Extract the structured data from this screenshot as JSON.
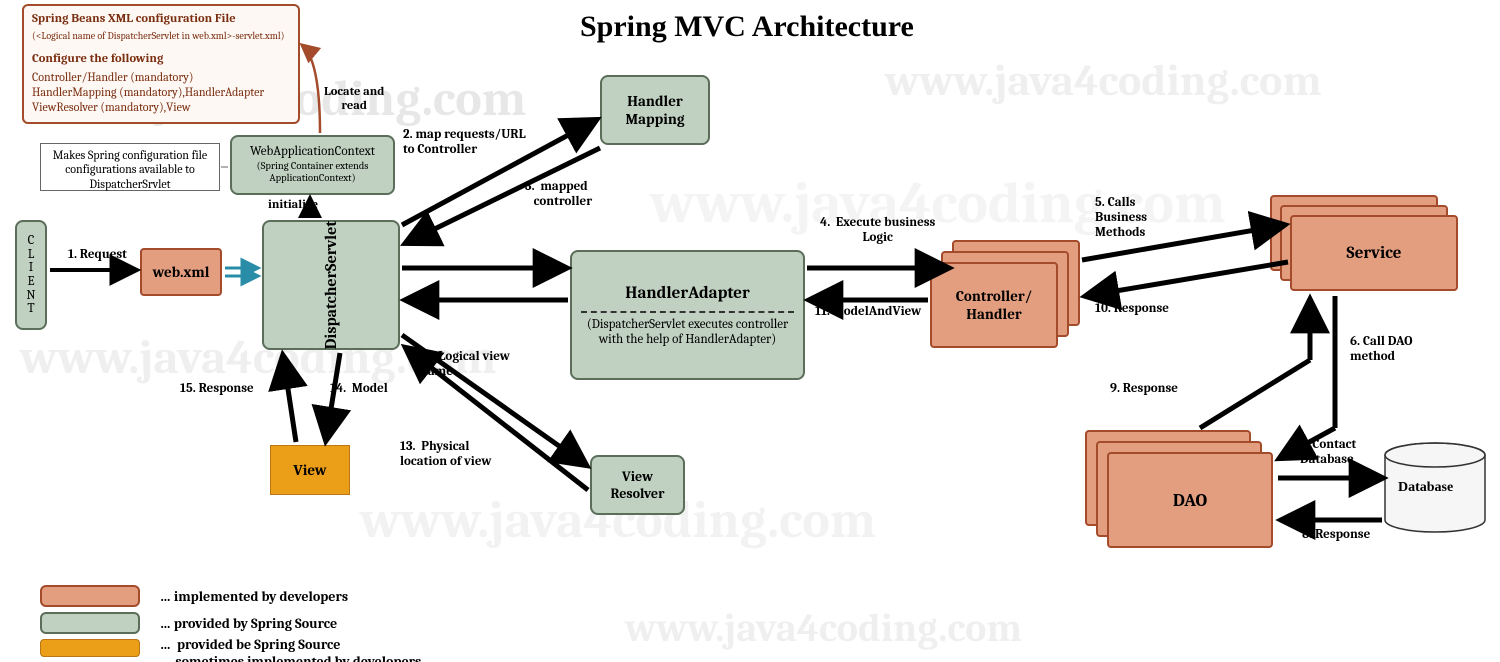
{
  "title": "Spring MVC Architecture",
  "watermark": "www.java4coding.com",
  "info_box": {
    "hdr1": "Spring Beans XML configuration File",
    "sub1": "(<Logical name of DispatcherServlet in web.xml>-servlet.xml)",
    "hdr2": "Configure the following",
    "l1": "Controller/Handler (mandatory)",
    "l2": "HandlerMapping (mandatory),HandlerAdapter",
    "l3": "ViewResolver (mandatory),View"
  },
  "makes_box": "Makes Spring configuration file configurations available to DispatcherSrvlet",
  "nodes": {
    "client": "C\nL\nI\nE\nN\nT",
    "webxml": "web.xml",
    "wac": "WebApplicationContext",
    "wac_sub": "(Spring Container extends ApplicationContext)",
    "dispatcher": "DispatcherServlet",
    "handler_mapping": "Handler\nMapping",
    "handler_adapter": "HandlerAdapter",
    "handler_adapter_sub": "(DispatcherServlet executes controller with the help of HandlerAdapter)",
    "controller": "Controller/\nHandler",
    "service": "Service",
    "dao": "DAO",
    "database": "Database",
    "view": "View",
    "view_resolver": "View\nResolver"
  },
  "edges": {
    "e1": "1. Request",
    "e2": "2. map requests/URL\nto Controller",
    "e3": "3.  mapped\n   controller",
    "e4": "4.  Execute business\nLogic",
    "e5": "5. Calls\nBusiness\nMethods",
    "e6": "6. Call DAO\nmethod",
    "e7": "7. Contact\nDatabase",
    "e8": "8. Response",
    "e9": "9. Response",
    "e10": "10. Response",
    "e11": "11. ModelAndView",
    "e12": "12. Logical view\nname",
    "e13": "13.  Physical\nlocation of view",
    "e14": "14.  Model",
    "e15": "15. Response",
    "locate": "Locate and\nread",
    "init": "initialize"
  },
  "legend": {
    "dev": "…  implemented by developers",
    "spring": "…  provided by Spring Source",
    "mixed": "…  provided be Spring Source\n     sometimes implemented by developers"
  }
}
